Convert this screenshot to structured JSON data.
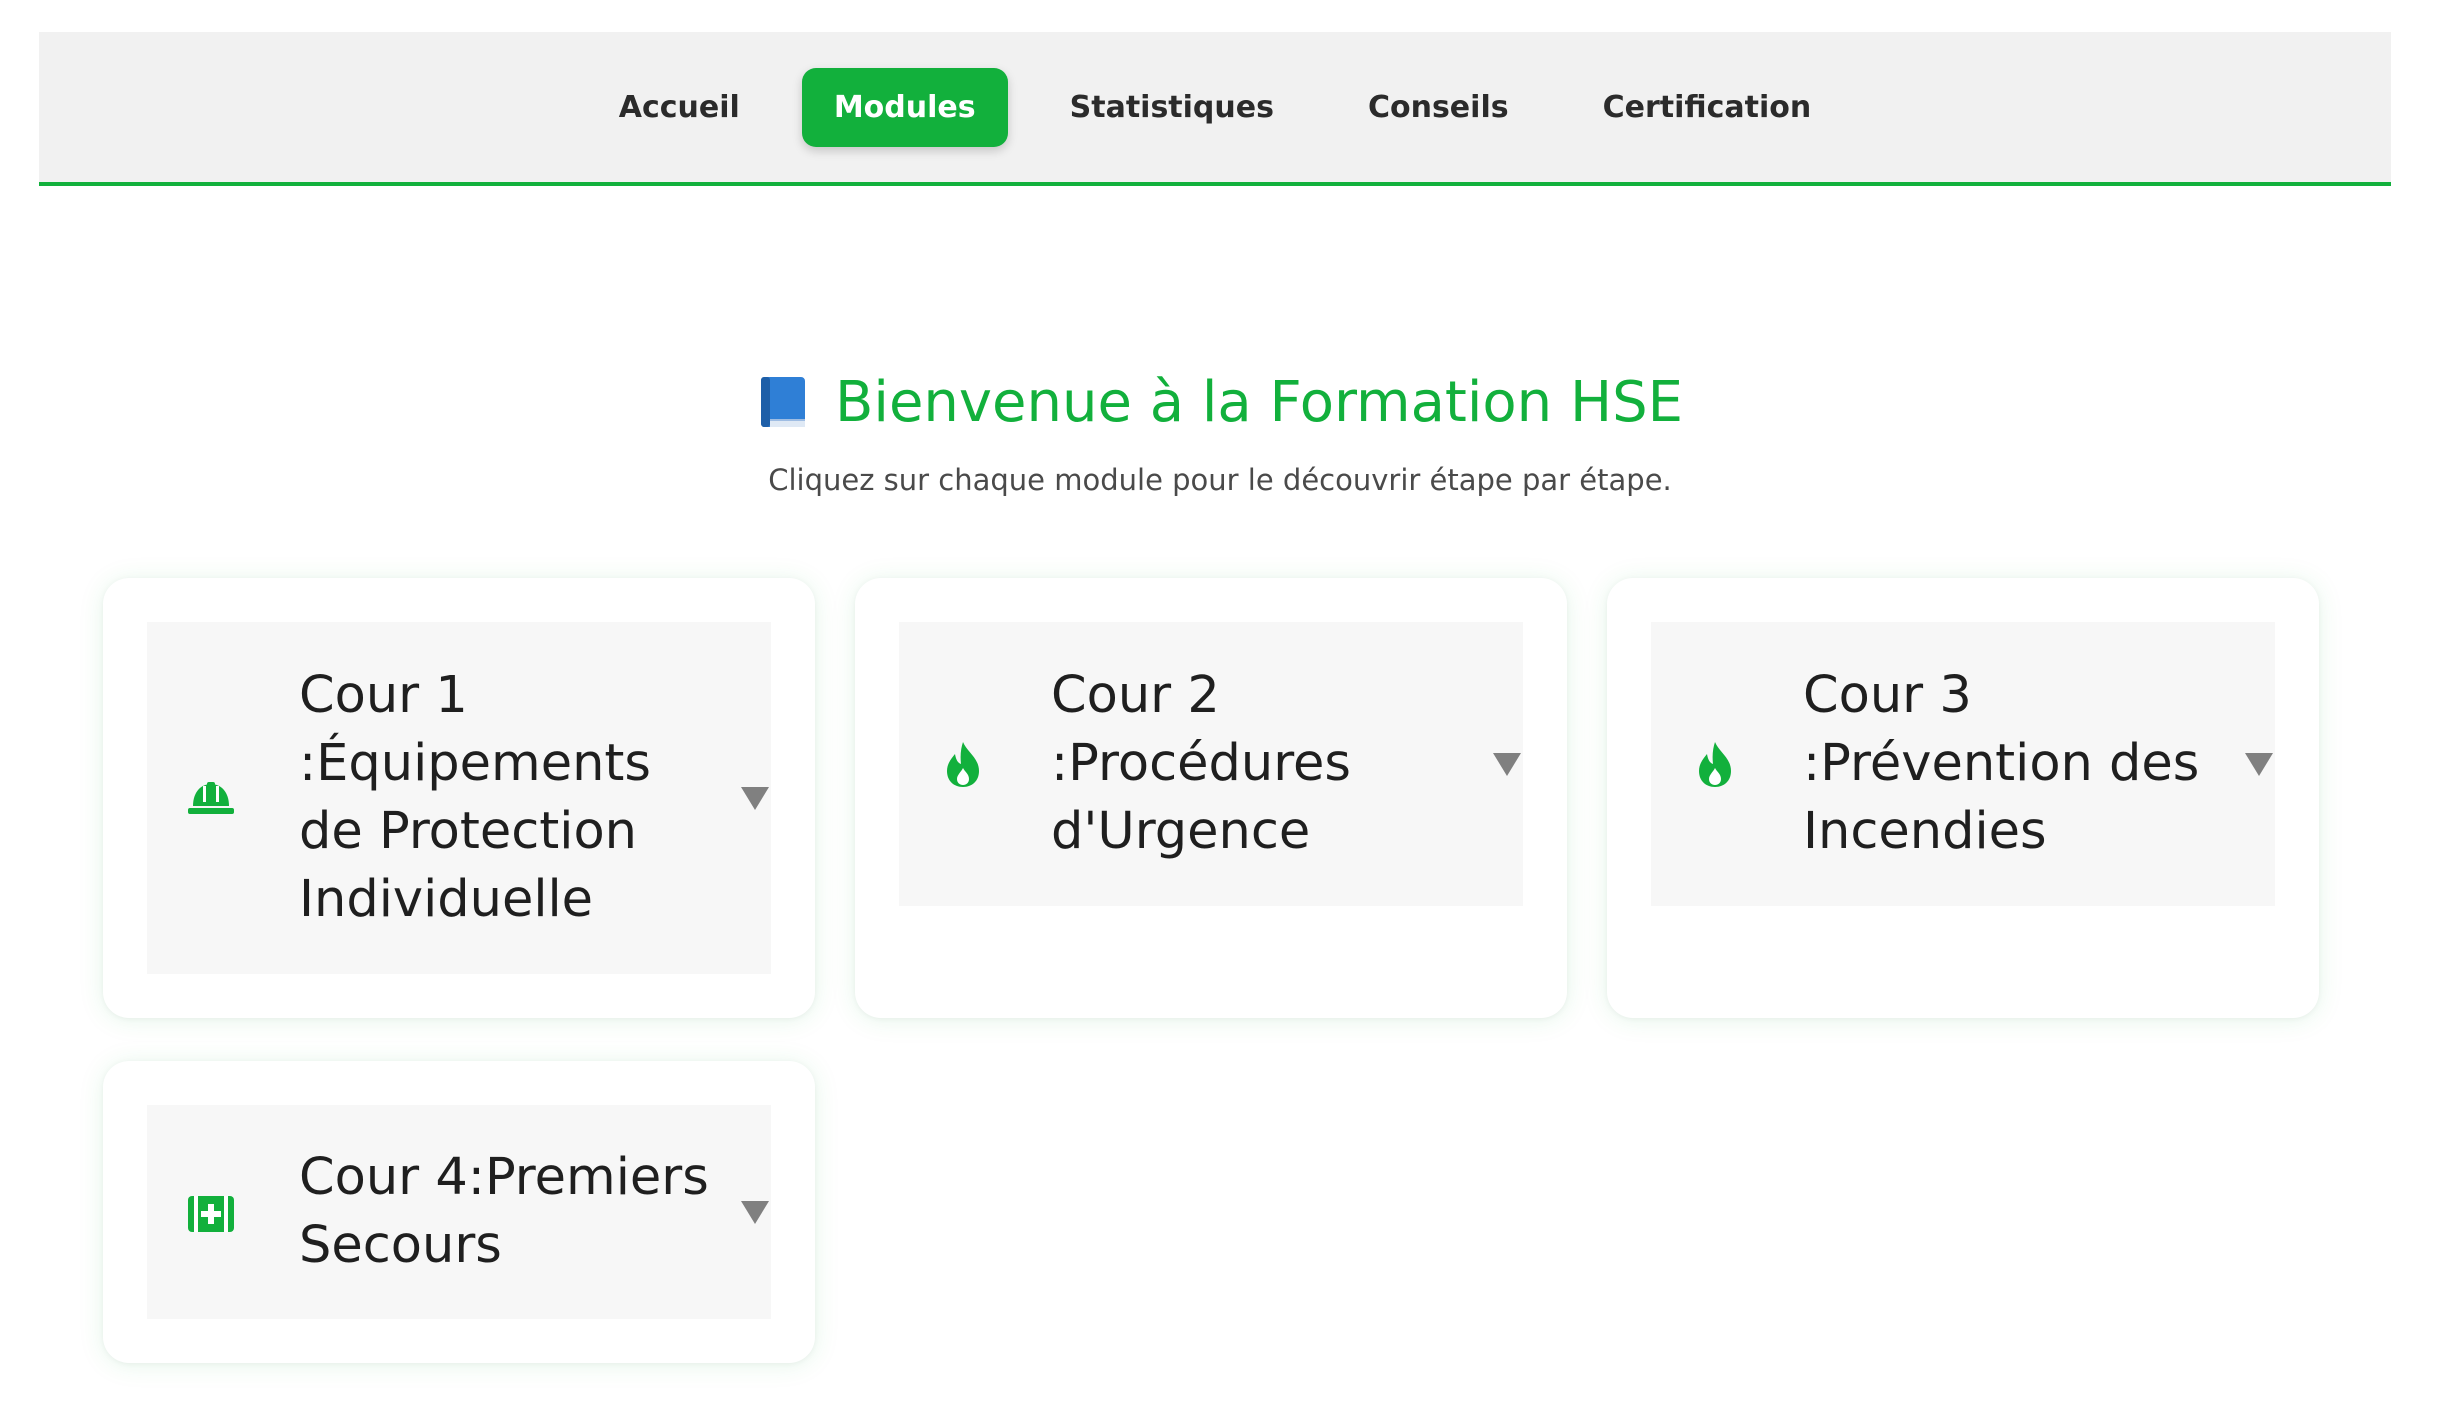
{
  "nav": {
    "items": [
      {
        "label": "Accueil",
        "active": false
      },
      {
        "label": "Modules",
        "active": true
      },
      {
        "label": "Statistiques",
        "active": false
      },
      {
        "label": "Conseils",
        "active": false
      },
      {
        "label": "Certification",
        "active": false
      }
    ]
  },
  "hero": {
    "icon": "blue-book-icon",
    "title": "Bienvenue à la Formation HSE",
    "subtitle": "Cliquez sur chaque module pour le découvrir étape par étape."
  },
  "modules": [
    {
      "title": "Cour 1 :Équipements de Protection Individuelle",
      "icon": "hard-hat-icon"
    },
    {
      "title": "Cour 2 :Procédures d'Urgence",
      "icon": "fire-icon"
    },
    {
      "title": "Cour 3 :Prévention des Incendies",
      "icon": "fire-icon"
    },
    {
      "title": "Cour 4:Premiers Secours",
      "icon": "first-aid-kit-icon"
    }
  ],
  "colors": {
    "accent": "#12b03c",
    "nav_bg": "#f1f1f1",
    "card_header_bg": "#f7f7f7",
    "text": "#1f1f1f",
    "chevron": "#808080",
    "book_blue": "#2f7fd6"
  }
}
